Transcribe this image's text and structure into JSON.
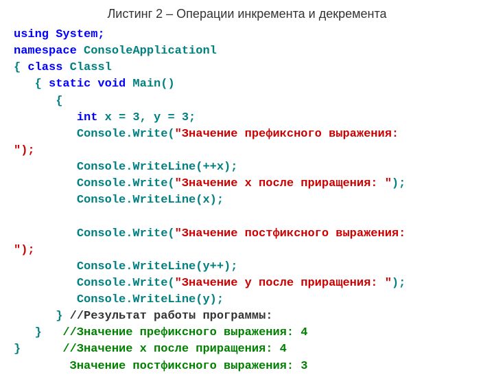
{
  "caption": "Листинг 2 – Операции инкремента и декремента",
  "code": {
    "l1": "using System;",
    "l2_a": "namespace",
    "l2_b": " ConsoleApplicationl",
    "l3_a": "{ ",
    "l3_b": "class",
    "l3_c": " Classl",
    "l4_a": "   { ",
    "l4_b": "static void",
    "l4_c": " Main()",
    "l5": "      {",
    "l6_a": "         int",
    "l6_b": " x = 3, y = 3;",
    "l7_a": "         Console.Write(",
    "l7_b": "\"Значение префиксного выражения:",
    "l8": "\");",
    "l9": "         Console.WriteLine(++x);",
    "l10_a": "         Console.Write(",
    "l10_b": "\"Значение x после приращения: \"",
    "l10_c": ");",
    "l11": "         Console.WriteLine(x);",
    "l12": "",
    "l13_a": "         Console.Write(",
    "l13_b": "\"Значение постфиксного выражения:",
    "l14": "\");",
    "l15": "         Console.WriteLine(y++);",
    "l16_a": "         Console.Write(",
    "l16_b": "\"Значение y после приращения: \"",
    "l16_c": ");",
    "l17": "         Console.WriteLine(y);",
    "l18_a": "      }",
    "l18_b": " //Результат работы программы:",
    "l19_a": "   }",
    "l19_b": "   //Значение префиксного выражения: 4",
    "l20_a": "}",
    "l20_b": "      //Значение x после приращения: 4",
    "l21": "        Значение постфиксного выражения: 3"
  }
}
